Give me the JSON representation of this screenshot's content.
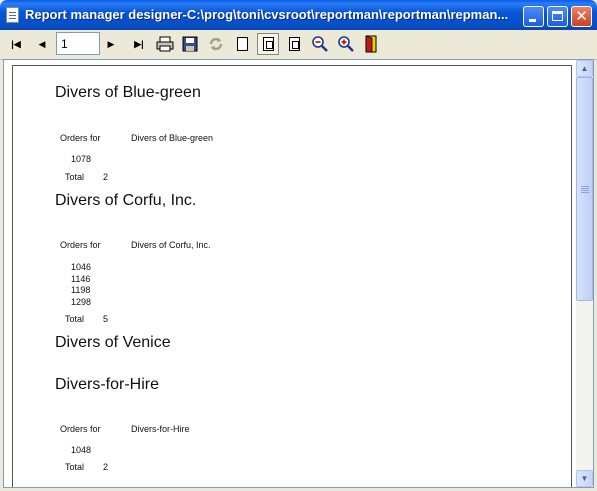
{
  "window": {
    "title": "Report manager designer-C:\\prog\\toni\\cvsroot\\reportman\\reportman\\repman...",
    "close_glyph": "✕"
  },
  "toolbar": {
    "first_glyph": "|◀",
    "prev_glyph": "◀",
    "page_value": "1",
    "next_glyph": "▶",
    "last_glyph": "▶|",
    "icons": [
      "first-page-icon",
      "previous-page-icon",
      "next-page-icon",
      "last-page-icon",
      "print-icon",
      "save-icon",
      "refresh-icon",
      "page-icon",
      "page-fit-icon",
      "page-width-icon",
      "zoom-out-icon",
      "zoom-in-icon",
      "exit-icon"
    ]
  },
  "report": {
    "groups": [
      {
        "name": "Divers of Blue-green",
        "orders_label": "Orders for",
        "customer": "Divers of Blue-green",
        "orders": [
          "1078"
        ],
        "total_label": "Total",
        "total": "2"
      },
      {
        "name": "Divers of Corfu, Inc.",
        "orders_label": "Orders for",
        "customer": "Divers of Corfu, Inc.",
        "orders": [
          "1046",
          "1146",
          "1198",
          "1298"
        ],
        "total_label": "Total",
        "total": "5"
      },
      {
        "name": "Divers of Venice"
      },
      {
        "name": "Divers-for-Hire",
        "orders_label": "Orders for",
        "customer": "Divers-for-Hire",
        "orders": [
          "1048"
        ],
        "total_label": "Total",
        "total": "2"
      }
    ]
  },
  "colors": {
    "titlebar": "#0a5ce8",
    "chrome": "#ece9d8",
    "close": "#c8431d"
  }
}
